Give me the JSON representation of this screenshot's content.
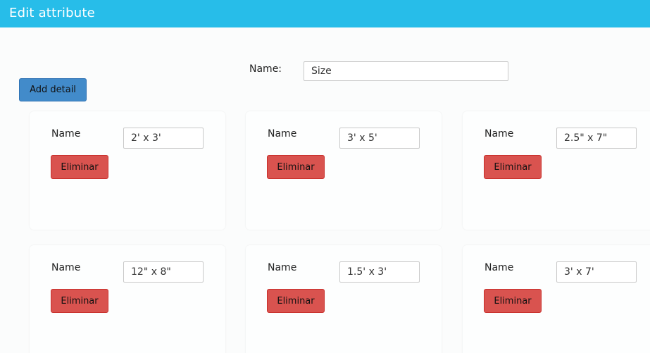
{
  "header": {
    "title": "Edit attribute"
  },
  "form": {
    "name_label": "Name:",
    "name_value": "Size"
  },
  "add_button_label": "Add detail",
  "details": [
    {
      "label": "Name",
      "value": "2' x 3'",
      "delete_label": "Eliminar"
    },
    {
      "label": "Name",
      "value": "3' x 5'",
      "delete_label": "Eliminar"
    },
    {
      "label": "Name",
      "value": "2.5\" x 7\"",
      "delete_label": "Eliminar"
    },
    {
      "label": "Name",
      "value": "12\" x 8\"",
      "delete_label": "Eliminar"
    },
    {
      "label": "Name",
      "value": "1.5' x 3'",
      "delete_label": "Eliminar"
    },
    {
      "label": "Name",
      "value": "3' x 7'",
      "delete_label": "Eliminar"
    }
  ],
  "colors": {
    "header": "#27bde9",
    "primary_button": "#428bca",
    "danger_button": "#d9534f"
  }
}
